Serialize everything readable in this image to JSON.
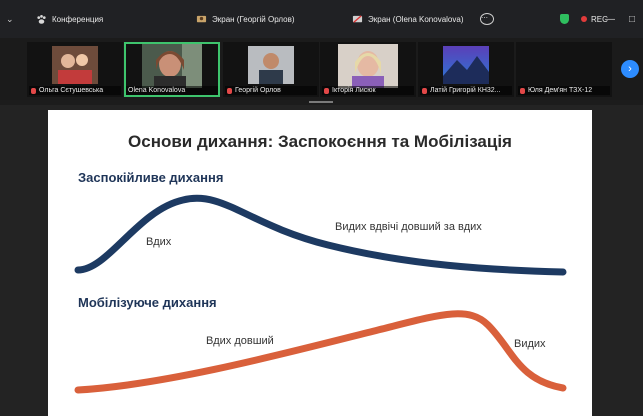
{
  "topbar": {
    "conference_label": "Конференция",
    "screen1_label": "Экран (Георгій Орлов)",
    "screen2_label": "Экран (Olena Konovalova)",
    "rec_label": "REC"
  },
  "participants": [
    {
      "name": "Ольга Сєтушевська",
      "muted": true
    },
    {
      "name": "Olena Konovalova",
      "muted": false
    },
    {
      "name": "Георгій Орлов",
      "muted": true
    },
    {
      "name": "Ікторія Лисюк",
      "muted": true
    },
    {
      "name": "Латій Григорій КН32...",
      "muted": true
    },
    {
      "name": "Юля Дем'ян ТЗХ-12",
      "muted": true
    }
  ],
  "slide": {
    "title": "Основи дихання: Заспокоєння та Мобілізація",
    "calm_heading": "Заспокійливе дихання",
    "calm_inhale": "Вдих",
    "calm_exhale": "Видих вдвічі довший за вдих",
    "mob_heading": "Мобілізуюче дихання",
    "mob_inhale": "Вдих довший",
    "mob_exhale": "Видих"
  },
  "colors": {
    "calm_curve": "#1d3a62",
    "mob_curve": "#d9603b",
    "active_border": "#3ec46d",
    "accent": "#2d8cff"
  },
  "icons": {
    "conference": "paw-icon",
    "screen1": "screen-share-icon",
    "screen2": "screen-share-icon",
    "security": "shield-icon",
    "recording": "rec-dot-icon",
    "next": "chevron-right-icon"
  }
}
